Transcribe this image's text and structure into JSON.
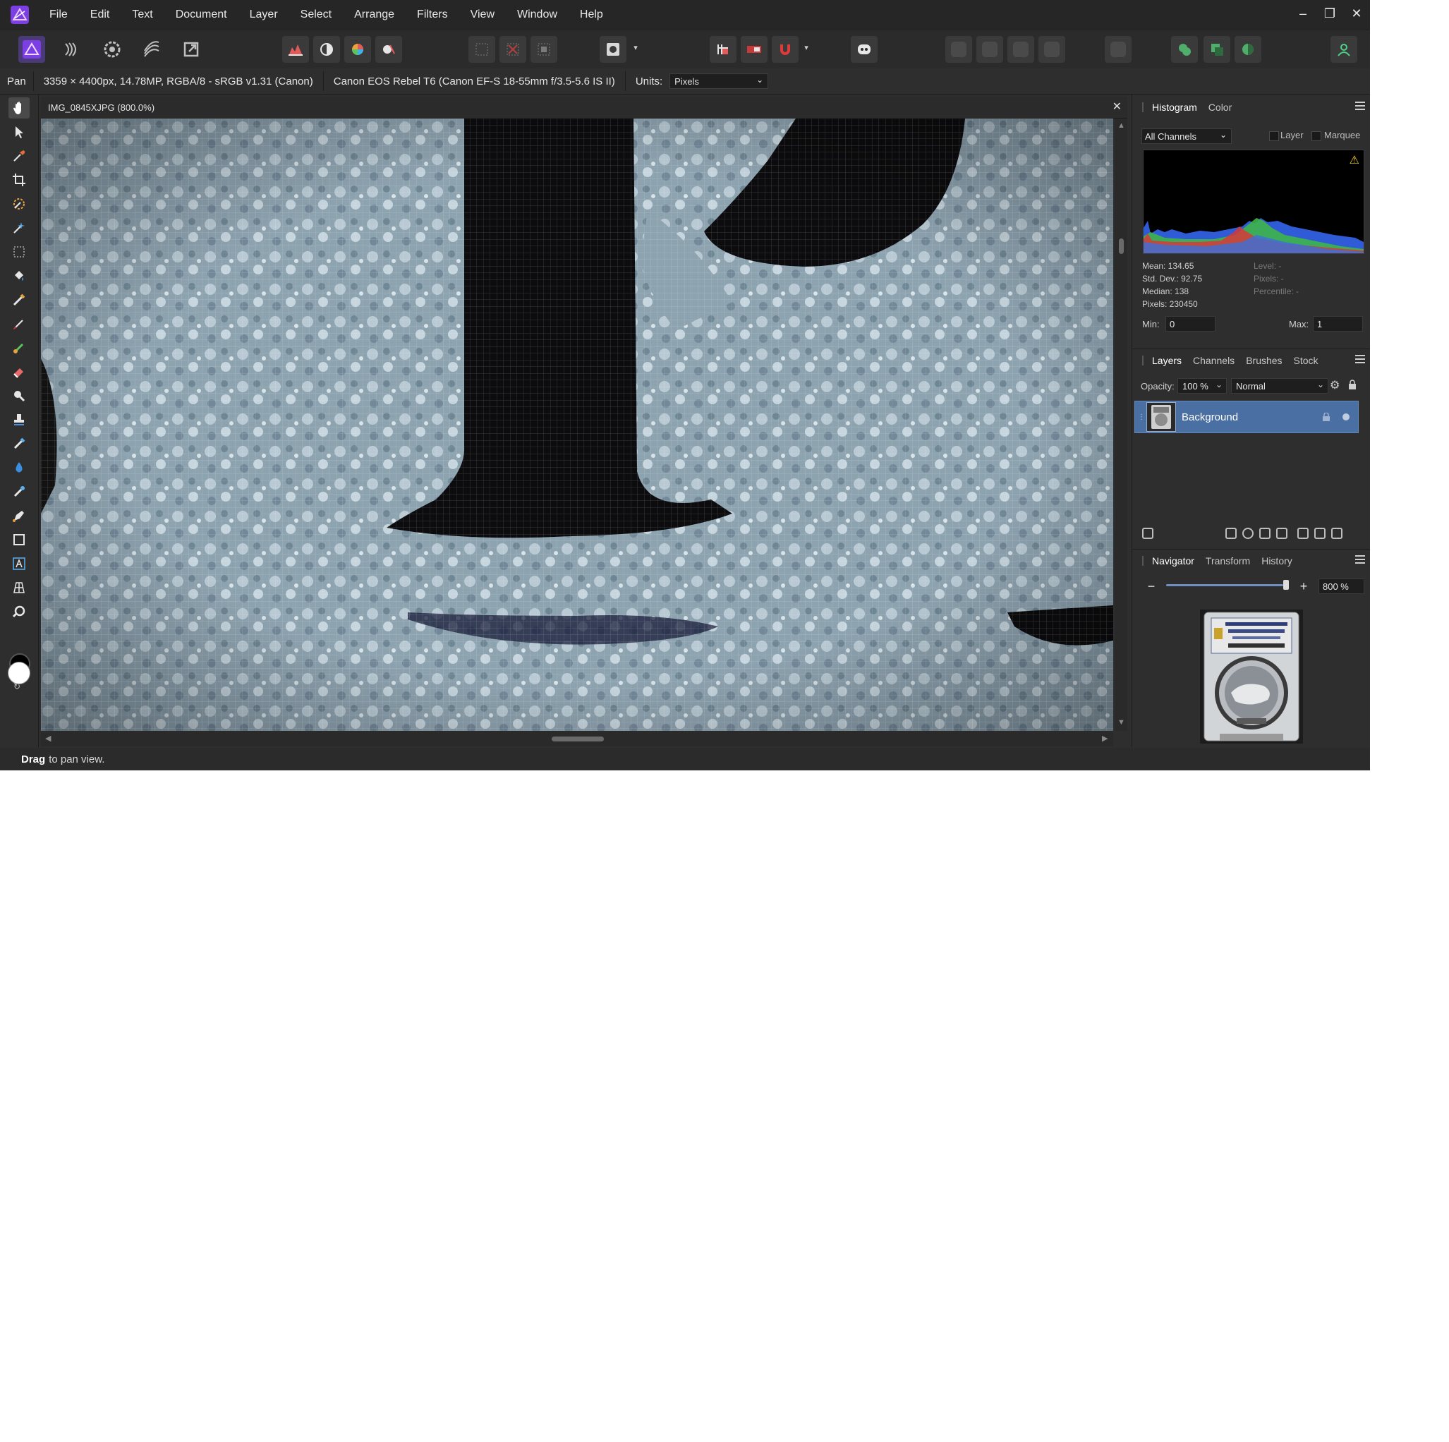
{
  "menu": [
    "File",
    "Edit",
    "Text",
    "Document",
    "Layer",
    "Select",
    "Arrange",
    "Filters",
    "View",
    "Window",
    "Help"
  ],
  "window_controls": {
    "minimize": "–",
    "restore": "❐",
    "close": "✕"
  },
  "context": {
    "tool": "Pan",
    "image_info": "3359 × 4400px, 14.78MP, RGBA/8 - sRGB v1.31 (Canon)",
    "camera": "Canon EOS Rebel T6 (Canon EF-S 18-55mm f/3.5-5.6 IS II)",
    "units_label": "Units:",
    "units_value": "Pixels"
  },
  "document": {
    "tab_title": "IMG_0845XJPG (800.0%)",
    "close": "✕"
  },
  "status": {
    "bold": "Drag",
    "text": "to pan view."
  },
  "histogram_panel": {
    "tabs": [
      "Histogram",
      "Color"
    ],
    "channel": "All Channels",
    "layer_label": "Layer",
    "marquee_label": "Marquee",
    "warning": "⚠",
    "stats_left": [
      "Mean: 134.65",
      "Std. Dev.: 92.75",
      "Median: 138",
      "Pixels: 230450"
    ],
    "stats_right": [
      "Level: -",
      "Pixels: -",
      "Percentile: -"
    ],
    "min_label": "Min:",
    "min_value": "0",
    "max_label": "Max:",
    "max_value": "1"
  },
  "layers_panel": {
    "tabs": [
      "Layers",
      "Channels",
      "Brushes",
      "Stock"
    ],
    "opacity_label": "Opacity:",
    "opacity_value": "100 %",
    "blend_mode": "Normal",
    "layers": [
      {
        "name": "Background"
      }
    ]
  },
  "navigator_panel": {
    "tabs": [
      "Navigator",
      "Transform",
      "History"
    ],
    "zoom_value": "800 %",
    "zoom_level": 0.92,
    "minus": "−",
    "plus": "+"
  },
  "colors": {
    "app_bg": "#2e2e2e",
    "menubar_bg": "#262626",
    "selected_layer": "#4a6fa2",
    "accent_logo": "#7b3fe4",
    "pixel_light": "#8fa6b4",
    "pixel_dark": "#0c0c0e"
  },
  "icons": {
    "personas": [
      "photo-persona-icon",
      "liquify-persona-icon",
      "develop-persona-icon",
      "tone-mapping-persona-icon",
      "export-persona-icon"
    ],
    "tools": [
      "hand-tool-icon",
      "move-tool-icon",
      "color-picker-icon",
      "crop-tool-icon",
      "selection-brush-icon",
      "flood-select-icon",
      "marquee-tool-icon",
      "flood-fill-icon",
      "fill-brush-icon",
      "paint-brush-icon",
      "pixel-tool-icon",
      "erase-brush-icon",
      "dodge-brush-icon",
      "clone-brush-icon",
      "healing-brush-icon",
      "blur-brush-icon",
      "red-eye-icon",
      "pen-tool-icon",
      "rectangle-tool-icon",
      "text-tool-icon",
      "mesh-warp-icon",
      "zoom-tool-icon"
    ]
  }
}
